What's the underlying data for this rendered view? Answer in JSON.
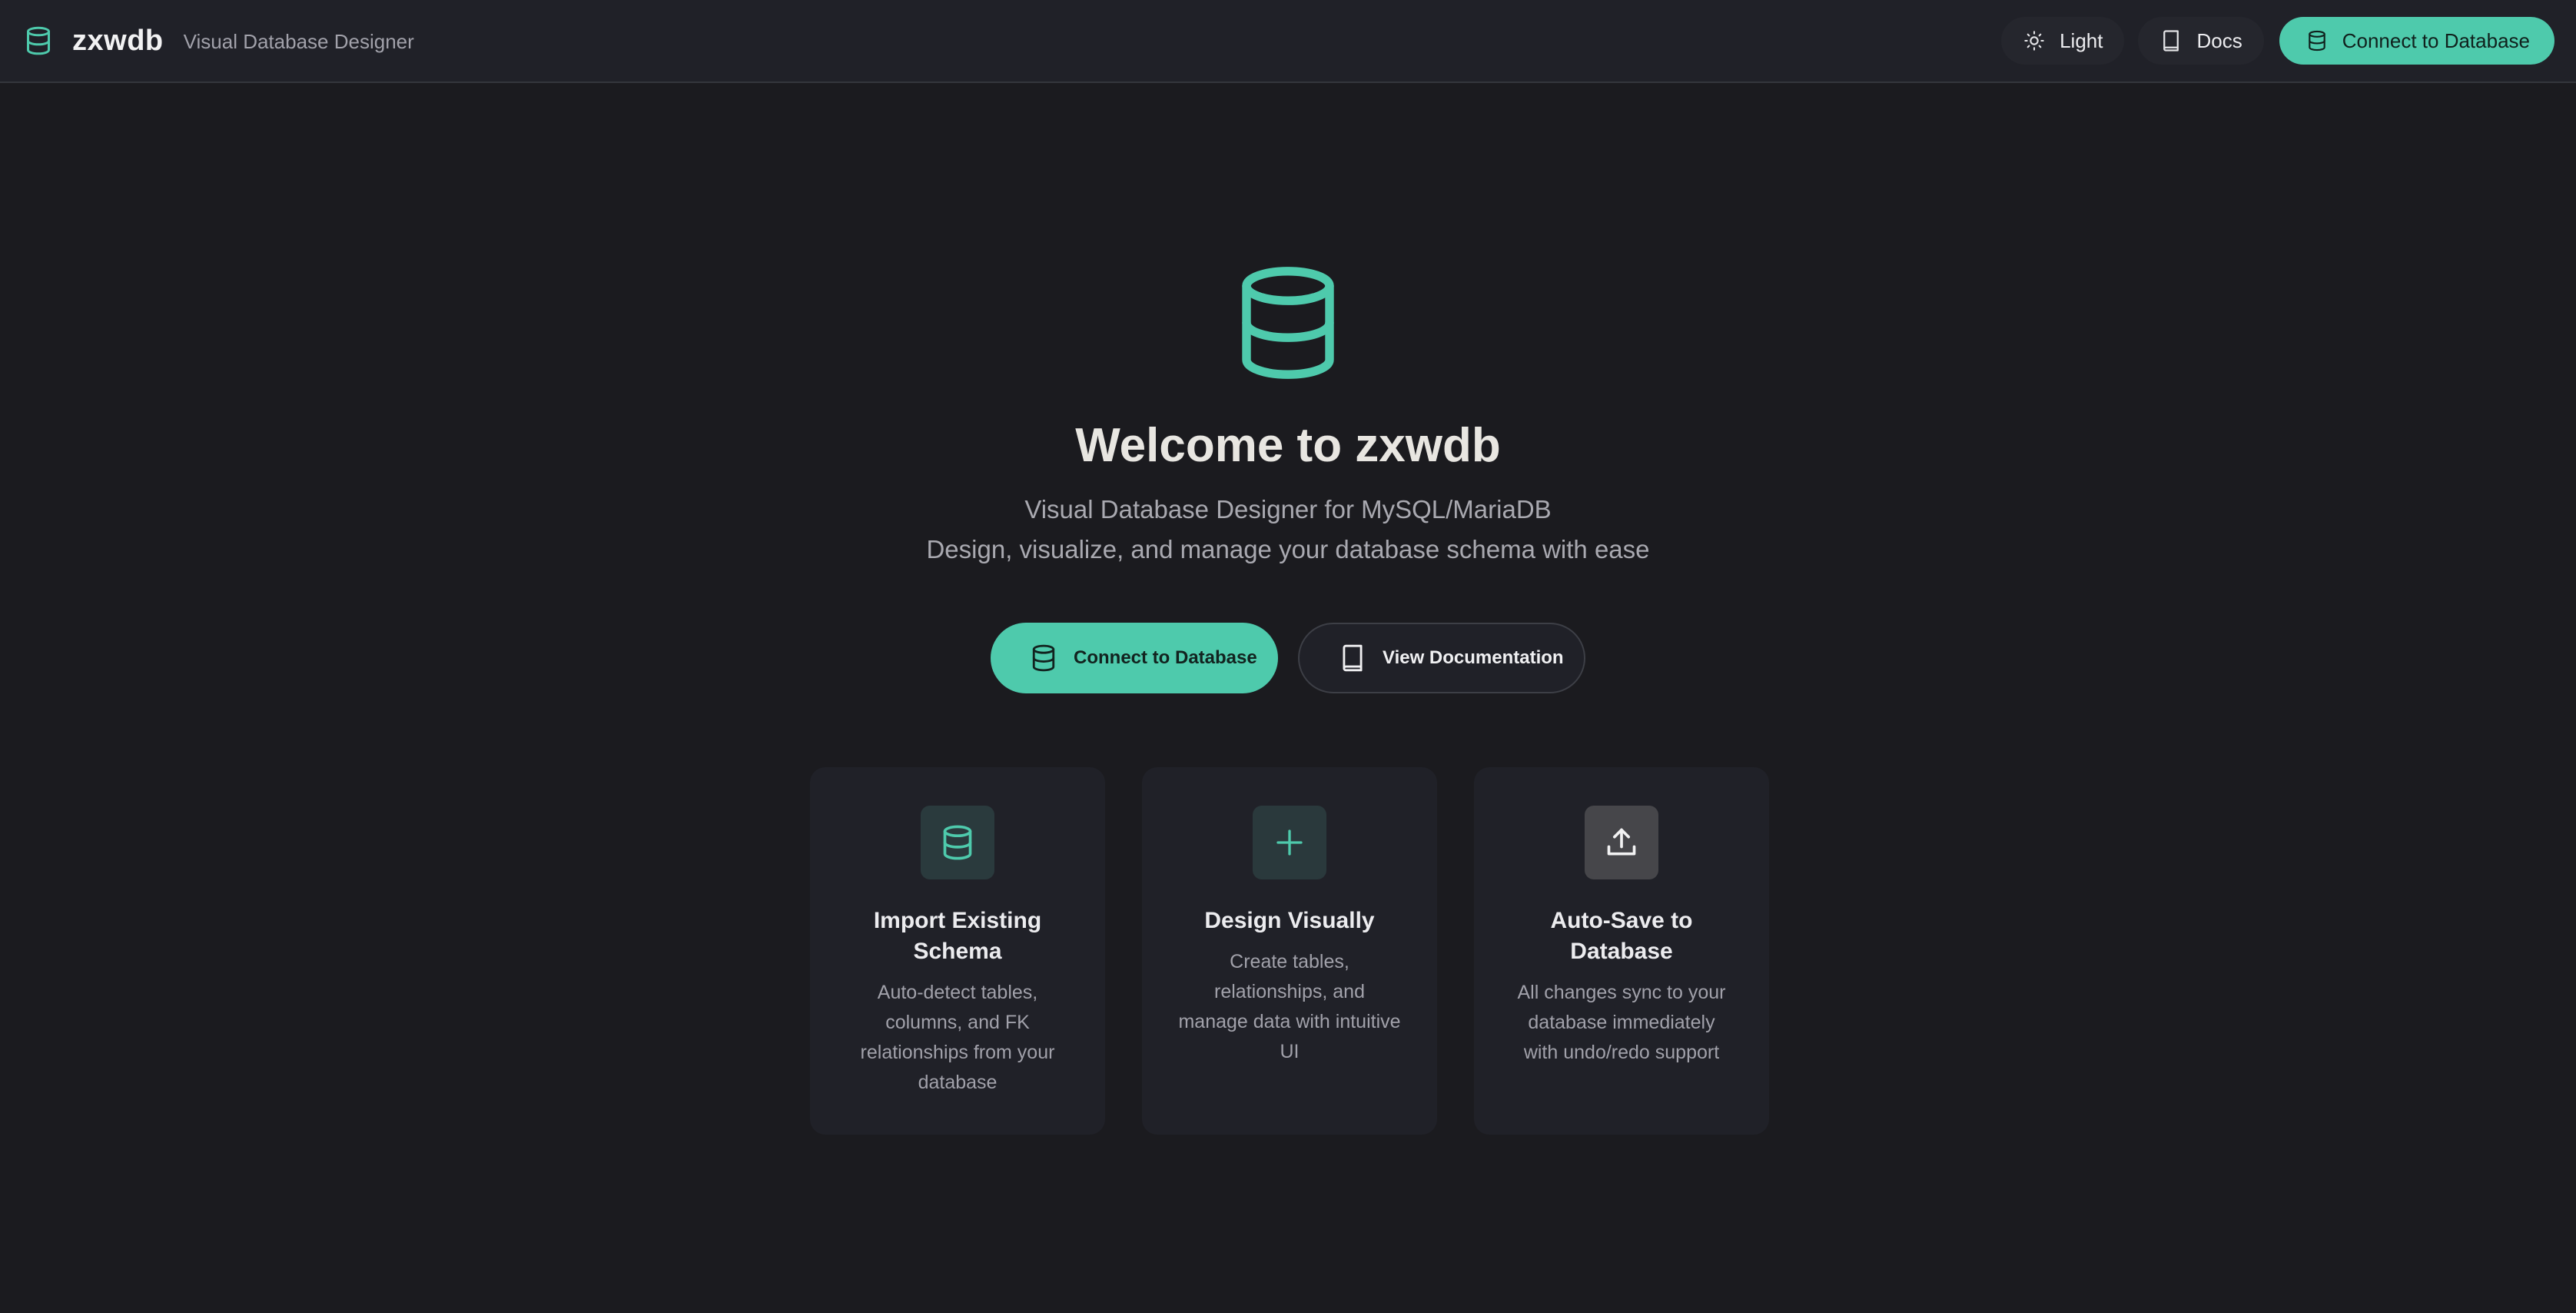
{
  "header": {
    "app_name": "zxwdb",
    "app_subtitle": "Visual Database Designer",
    "theme_toggle_label": "Light",
    "docs_label": "Docs",
    "connect_label": "Connect to Database"
  },
  "hero": {
    "title": "Welcome to zxwdb",
    "subtitle_line1": "Visual Database Designer for MySQL/MariaDB",
    "subtitle_line2": "Design, visualize, and manage your database schema with ease",
    "primary_cta": "Connect to Database",
    "secondary_cta": "View Documentation"
  },
  "features": [
    {
      "icon": "database-icon",
      "title": "Import Existing Schema",
      "description": "Auto-detect tables, columns, and FK relationships from your database"
    },
    {
      "icon": "plus-icon",
      "title": "Design Visually",
      "description": "Create tables, relationships, and manage data with intuitive UI"
    },
    {
      "icon": "upload-icon",
      "title": "Auto-Save to Database",
      "description": "All changes sync to your database immediately with undo/redo support"
    }
  ],
  "colors": {
    "accent": "#4ecaac",
    "background": "#1b1b1f",
    "surface": "#202128"
  }
}
